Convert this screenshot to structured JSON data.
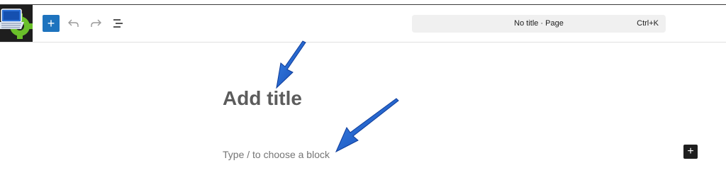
{
  "toolbar": {
    "logo_name": "site-logo",
    "add_block_icon": "plus-icon",
    "undo_icon": "undo-icon",
    "redo_icon": "redo-icon",
    "document_overview_icon": "list-view-icon",
    "add_symbol": "+",
    "command_bar": {
      "title": "No title · Page",
      "shortcut": "Ctrl+K"
    }
  },
  "editor": {
    "title_placeholder": "Add title",
    "block_placeholder": "Type / to choose a block",
    "inline_add_symbol": "+"
  },
  "colors": {
    "accent": "#1e73be",
    "arrow": "#1f5fc9",
    "dark": "#1e1e1e"
  }
}
